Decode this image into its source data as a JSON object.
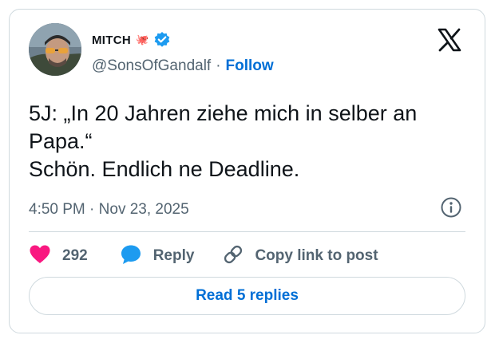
{
  "author": {
    "display_name": "MITCH",
    "name_emoji": "🐙",
    "handle": "@SonsOfGandalf",
    "separator": "·",
    "follow_label": "Follow",
    "verified_color": "#1d9bf0"
  },
  "tweet": {
    "lines": [
      "5J: „In 20 Jahren ziehe mich in selber an",
      "Papa.“",
      "Schön. Endlich ne Deadline."
    ],
    "time": "4:50 PM",
    "separator": "·",
    "date": "Nov 23, 2025"
  },
  "actions": {
    "like_count": "292",
    "reply_label": "Reply",
    "copy_link_label": "Copy link to post"
  },
  "read_replies_label": "Read 5 replies",
  "icons": {
    "brand": "x-logo-icon",
    "info": "info-icon",
    "like": "heart-icon",
    "reply": "speech-bubble-icon",
    "copy": "link-icon",
    "verified": "verified-badge-icon"
  },
  "colors": {
    "like": "#f91880",
    "reply": "#1d9bf0",
    "link": "#006fd6",
    "muted": "#536471",
    "border": "#cfd9de"
  }
}
